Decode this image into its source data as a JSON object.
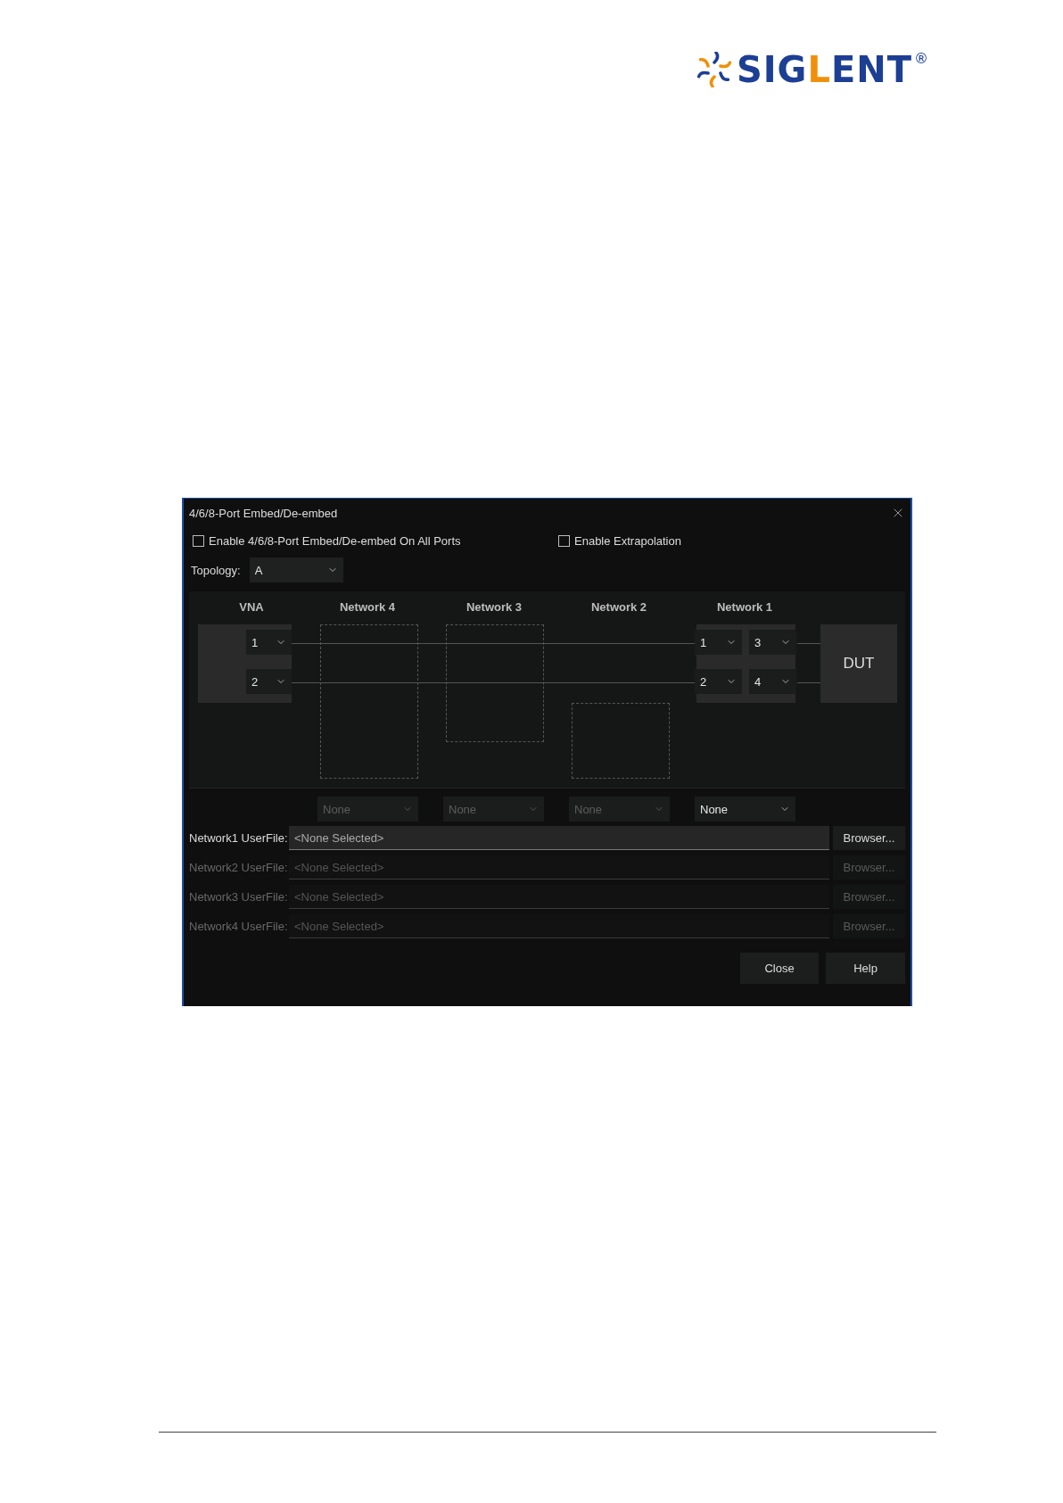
{
  "logo": {
    "parts": [
      {
        "text": "SIG",
        "color": "#1c3f94"
      },
      {
        "text": "L",
        "color": "#f0900a"
      },
      {
        "text": "ENT",
        "color": "#1c3f94"
      }
    ],
    "mark": "®"
  },
  "dialog": {
    "title": "4/6/8-Port Embed/De-embed",
    "options": [
      {
        "label": "Enable 4/6/8-Port Embed/De-embed On All Ports",
        "checked": false
      },
      {
        "label": "Enable Extrapolation",
        "checked": false
      }
    ],
    "topology": {
      "label": "Topology:",
      "value": "A"
    },
    "diagram": {
      "headers": [
        "VNA",
        "Network 4",
        "Network 3",
        "Network 2",
        "Network 1"
      ],
      "vna_ports": [
        "1",
        "2"
      ],
      "network1_ports": [
        "1",
        "3",
        "2",
        "4"
      ],
      "dut": "DUT"
    },
    "network_selectors": [
      {
        "value": "None",
        "disabled": true
      },
      {
        "value": "None",
        "disabled": true
      },
      {
        "value": "None",
        "disabled": true
      },
      {
        "value": "None",
        "disabled": false
      }
    ],
    "files": [
      {
        "label": "Network1 UserFile:",
        "placeholder": "<None Selected>",
        "button": "Browser...",
        "disabled": false
      },
      {
        "label": "Network2 UserFile:",
        "placeholder": "<None Selected>",
        "button": "Browser...",
        "disabled": true
      },
      {
        "label": "Network3 UserFile:",
        "placeholder": "<None Selected>",
        "button": "Browser...",
        "disabled": true
      },
      {
        "label": "Network4 UserFile:",
        "placeholder": "<None Selected>",
        "button": "Browser...",
        "disabled": true
      }
    ],
    "buttons": [
      "Close",
      "Help"
    ]
  }
}
